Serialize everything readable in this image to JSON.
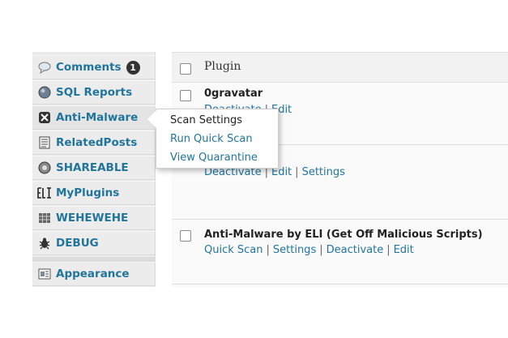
{
  "sidebar": {
    "items": [
      {
        "label": "Comments",
        "icon": "comments-icon",
        "badge": "1"
      },
      {
        "label": "SQL Reports",
        "icon": "database-icon"
      },
      {
        "label": "Anti-Malware",
        "icon": "anti-malware-icon"
      },
      {
        "label": "RelatedPosts",
        "icon": "related-posts-icon"
      },
      {
        "label": "SHAREABLE",
        "icon": "shareable-icon"
      },
      {
        "label": "MyPlugins",
        "icon": "eli-logo-icon"
      },
      {
        "label": "WEHEWEHE",
        "icon": "grid-icon"
      },
      {
        "label": "DEBUG",
        "icon": "bug-icon"
      },
      {
        "label": "Appearance",
        "icon": "appearance-icon"
      }
    ]
  },
  "flyout": {
    "items": [
      {
        "label": "Scan Settings"
      },
      {
        "label": "Run Quick Scan"
      },
      {
        "label": "View Quarantine"
      }
    ]
  },
  "table": {
    "header": "Plugin",
    "rows": [
      {
        "name": "0gravatar",
        "actions": [
          "Deactivate",
          "Edit"
        ]
      },
      {
        "name": "",
        "actions": [
          "Deactivate",
          "Edit",
          "Settings"
        ]
      },
      {
        "name": "Anti-Malware by ELI (Get Off Malicious Scripts)",
        "actions": [
          "Quick Scan",
          "Settings",
          "Deactivate",
          "Edit"
        ]
      }
    ]
  },
  "colors": {
    "link": "#21759b",
    "sidebar_bg": "#ececec"
  }
}
